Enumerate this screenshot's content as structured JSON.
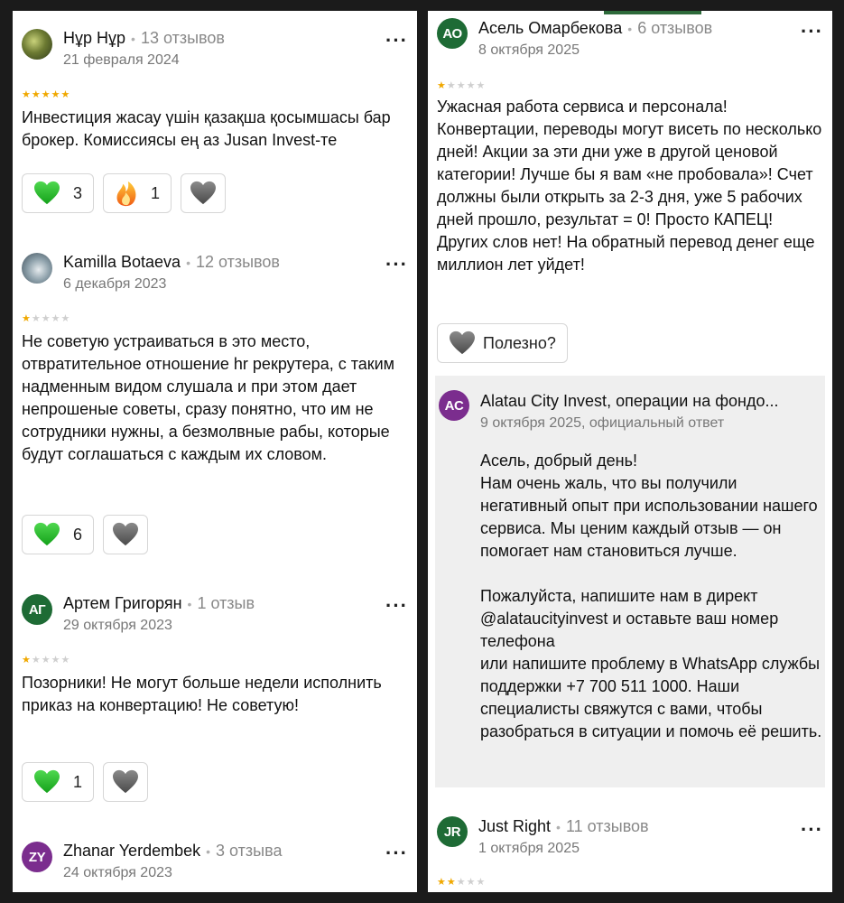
{
  "left": {
    "reviews": [
      {
        "author": "Нұр Нұр",
        "count": "13 отзывов",
        "date": "21 февраля 2024",
        "rating": 5,
        "text": "Инвестиция жасау үшін қазақша қосымшасы бар брокер. Комиссиясы ең аз Jusan Invest-те",
        "reactions": {
          "heart": "3",
          "fire": "1"
        }
      },
      {
        "author": "Kamilla Botaeva",
        "count": "12 отзывов",
        "date": "6 декабря 2023",
        "rating": 1,
        "text": "Не советую устраиваться в это место, отвратительное отношение hr рекрутера, с таким надменным видом слушала и при этом дает непрошеные советы, сразу понятно, что им не сотрудники нужны, а безмолвные рабы, которые будут соглашаться с каждым их словом.",
        "reactions": {
          "heart": "6"
        }
      },
      {
        "author": "Артем Григорян",
        "initials": "АГ",
        "count": "1 отзыв",
        "date": "29 октября 2023",
        "rating": 1,
        "text": "Позорники! Не могут больше недели исполнить приказ на конвертацию! Не советую!",
        "reactions": {
          "heart": "1"
        }
      },
      {
        "author": "Zhanar Yerdembek",
        "initials": "ZY",
        "count": "3 отзыва",
        "date": "24 октября 2023"
      }
    ]
  },
  "right": {
    "review1": {
      "author": "Асель Омарбекова",
      "initials": "АО",
      "count": "6 отзывов",
      "date": "8 октября 2025",
      "rating": 1,
      "text": "Ужасная работа сервиса и персонала! Конвертации, переводы могут висеть по несколько дней! Акции за эти дни уже в другой ценовой категории! Лучше бы я вам «не пробовала»! Счет должны были открыть за 2-3 дня, уже 5 рабочих дней прошло, результат = 0! Просто КАПЕЦ! Других слов нет! На обратный перевод денег еще миллион лет уйдет!",
      "useful_label": "Полезно?"
    },
    "reply": {
      "author": "Alatau City Invest, операции на фондо...",
      "initials": "AC",
      "meta": "9 октября 2025, официальный ответ",
      "text": "Асель, добрый день!\nНам очень жаль, что вы получили негативный опыт при использовании нашего сервиса. Мы ценим каждый отзыв — он помогает нам становиться лучше.\n\nПожалуйста, напишите нам в директ @alataucityinvest и оставьте ваш номер телефона\nили напишите проблему в WhatsApp службы поддержки +7 700 511 1000. Наши специалисты свяжутся с вами, чтобы разобраться в ситуации и помочь её решить."
    },
    "review2": {
      "author": "Just Right",
      "initials": "JR",
      "count": "11 отзывов",
      "date": "1 октября 2025",
      "rating": 2
    }
  },
  "colors": {
    "green_avatar": "#1e6b35",
    "purple_avatar": "#7b2d8e",
    "star": "#f0a800",
    "reply_bg": "#efefef"
  },
  "icons": [
    "heart-icon",
    "fire-icon",
    "more-icon",
    "star-icon"
  ]
}
